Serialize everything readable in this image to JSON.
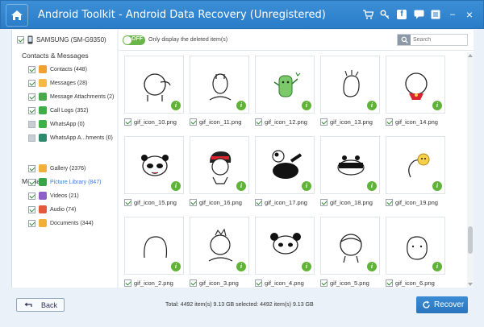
{
  "app": {
    "title": "Android Toolkit - Android Data Recovery (Unregistered)"
  },
  "titlebar_icons": [
    "cart-icon",
    "key-icon",
    "facebook-icon",
    "chat-icon",
    "menu-icon",
    "minimize-icon",
    "close-icon"
  ],
  "titlebar_labels": {
    "facebook": "f",
    "minimize": "–",
    "close": "×"
  },
  "colors": {
    "accent": "#2a7cc8",
    "toggle_green": "#6ab547",
    "info_green": "#5fb336",
    "link_blue": "#3a7bd5"
  },
  "device": {
    "name": "SAMSUNG (SM-G9350)"
  },
  "sidebar": {
    "contacts_section": "Contacts & Messages",
    "media_section": "Media",
    "contacts_items": [
      {
        "label": "Contacts (448)",
        "checked": true,
        "icon": "contacts-icon",
        "color": "#f0a030"
      },
      {
        "label": "Messages (28)",
        "checked": true,
        "icon": "messages-icon",
        "color": "#f5b945"
      },
      {
        "label": "Message Attachments (2)",
        "checked": true,
        "icon": "attachment-icon",
        "color": "#4aa84a"
      },
      {
        "label": "Call Logs (352)",
        "checked": true,
        "icon": "phone-icon",
        "color": "#3fae4a"
      },
      {
        "label": "WhatsApp (0)",
        "checked": false,
        "icon": "whatsapp-icon",
        "color": "#3db149"
      },
      {
        "label": "WhatsApp A...hments (0)",
        "checked": false,
        "icon": "whatsapp-attachment-icon",
        "color": "#2e8a6d"
      }
    ],
    "media_items": [
      {
        "label": "Gallery (2376)",
        "checked": true,
        "icon": "gallery-icon",
        "color": "#f0b03a"
      },
      {
        "label": "Picture Library (847)",
        "checked": true,
        "active": true,
        "icon": "picture-library-icon",
        "color": "#3aa34a"
      },
      {
        "label": "Videos (21)",
        "checked": true,
        "icon": "video-icon",
        "color": "#8e5fc7"
      },
      {
        "label": "Audio (74)",
        "checked": true,
        "icon": "audio-icon",
        "color": "#e25a3a"
      },
      {
        "label": "Documents (344)",
        "checked": true,
        "icon": "documents-icon",
        "color": "#f0b03a"
      }
    ]
  },
  "toolbar": {
    "toggle_text": "OFF",
    "only_deleted_label": "Only display the deleted item(s)",
    "search_placeholder": "Search"
  },
  "files": [
    "gif_icon_10.png",
    "gif_icon_11.png",
    "gif_icon_12.png",
    "gif_icon_13.png",
    "gif_icon_14.png",
    "gif_icon_15.png",
    "gif_icon_16.png",
    "gif_icon_17.png",
    "gif_icon_18.png",
    "gif_icon_19.png",
    "gif_icon_2.png",
    "gif_icon_3.png",
    "gif_icon_4.png",
    "gif_icon_5.png",
    "gif_icon_6.png"
  ],
  "info_label": "i",
  "footer": {
    "back_label": "Back",
    "totals": "Total: 4492 item(s) 9.13 GB   selected: 4492 item(s) 9.13 GB",
    "recover_label": "Recover"
  }
}
